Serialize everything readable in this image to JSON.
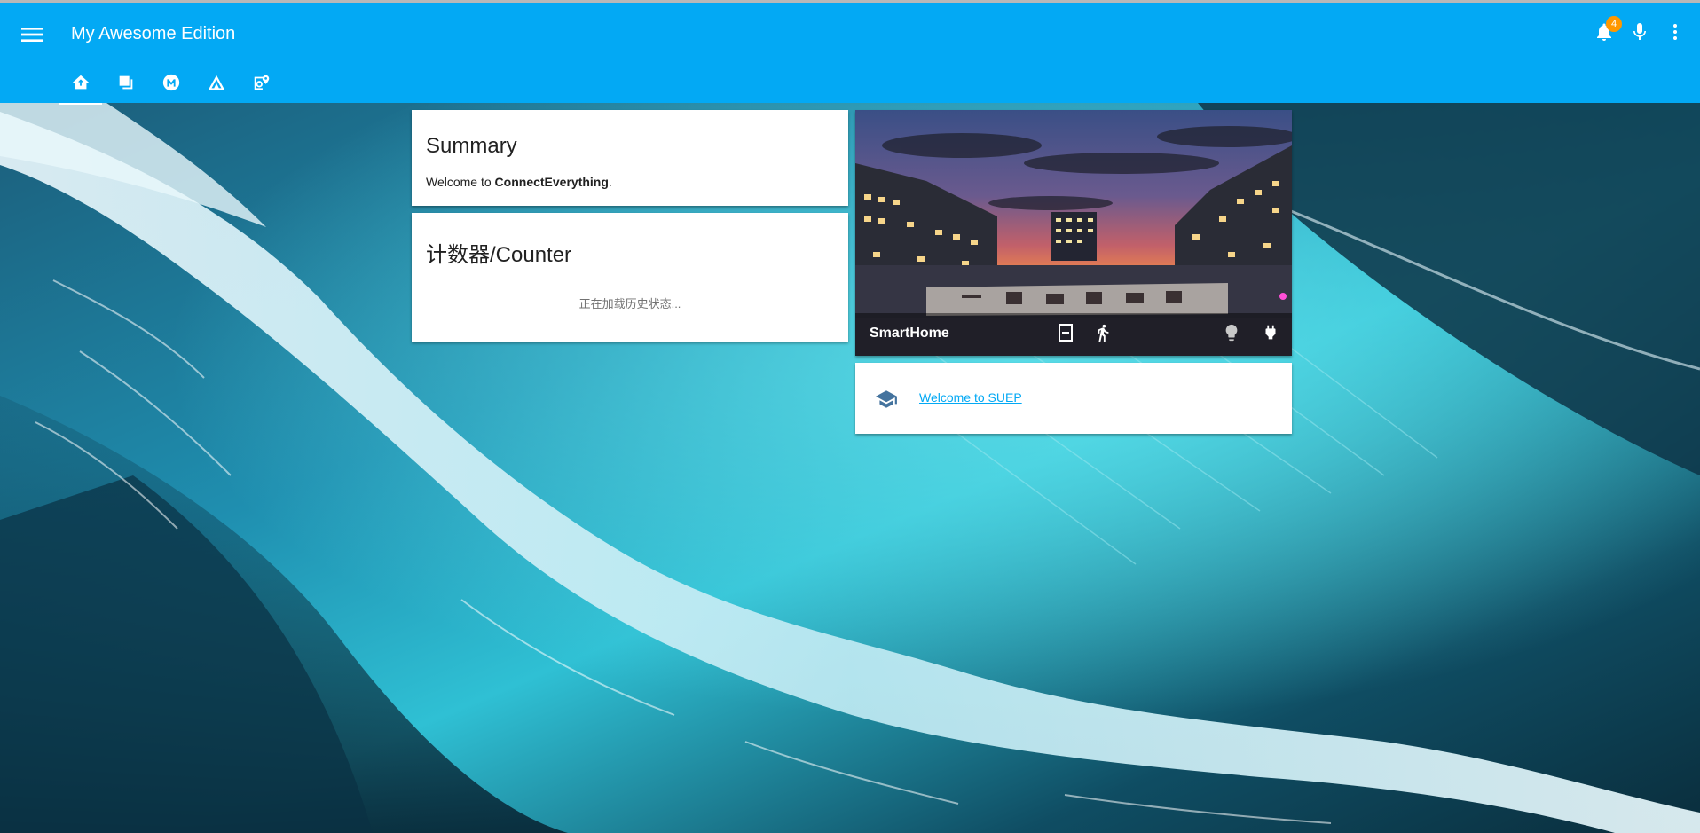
{
  "app": {
    "title": "My Awesome Edition",
    "accent_color": "#03a9f4"
  },
  "toolbar": {
    "menu_icon": "menu-icon",
    "notifications": {
      "icon": "bell-icon",
      "count": "4"
    },
    "voice_icon": "microphone-icon",
    "overflow_icon": "dots-vertical-icon"
  },
  "tabs": [
    {
      "icon": "home-automation-icon",
      "active": true
    },
    {
      "icon": "layers-icon",
      "active": false
    },
    {
      "icon": "metro-icon",
      "active": false
    },
    {
      "icon": "tent-icon",
      "active": false
    },
    {
      "icon": "map-search-icon",
      "active": false
    }
  ],
  "cards": {
    "summary": {
      "title": "Summary",
      "text_prefix": "Welcome to ",
      "text_bold": "ConnectEverything",
      "text_suffix": "."
    },
    "counter": {
      "title": "计数器/Counter",
      "loading": "正在加载历史状态..."
    },
    "picture": {
      "title": "SmartHome",
      "icons": [
        "door-icon",
        "walk-icon",
        "lightbulb-icon",
        "power-plug-icon"
      ]
    },
    "link": {
      "icon": "school-icon",
      "text": "Welcome to SUEP"
    }
  }
}
